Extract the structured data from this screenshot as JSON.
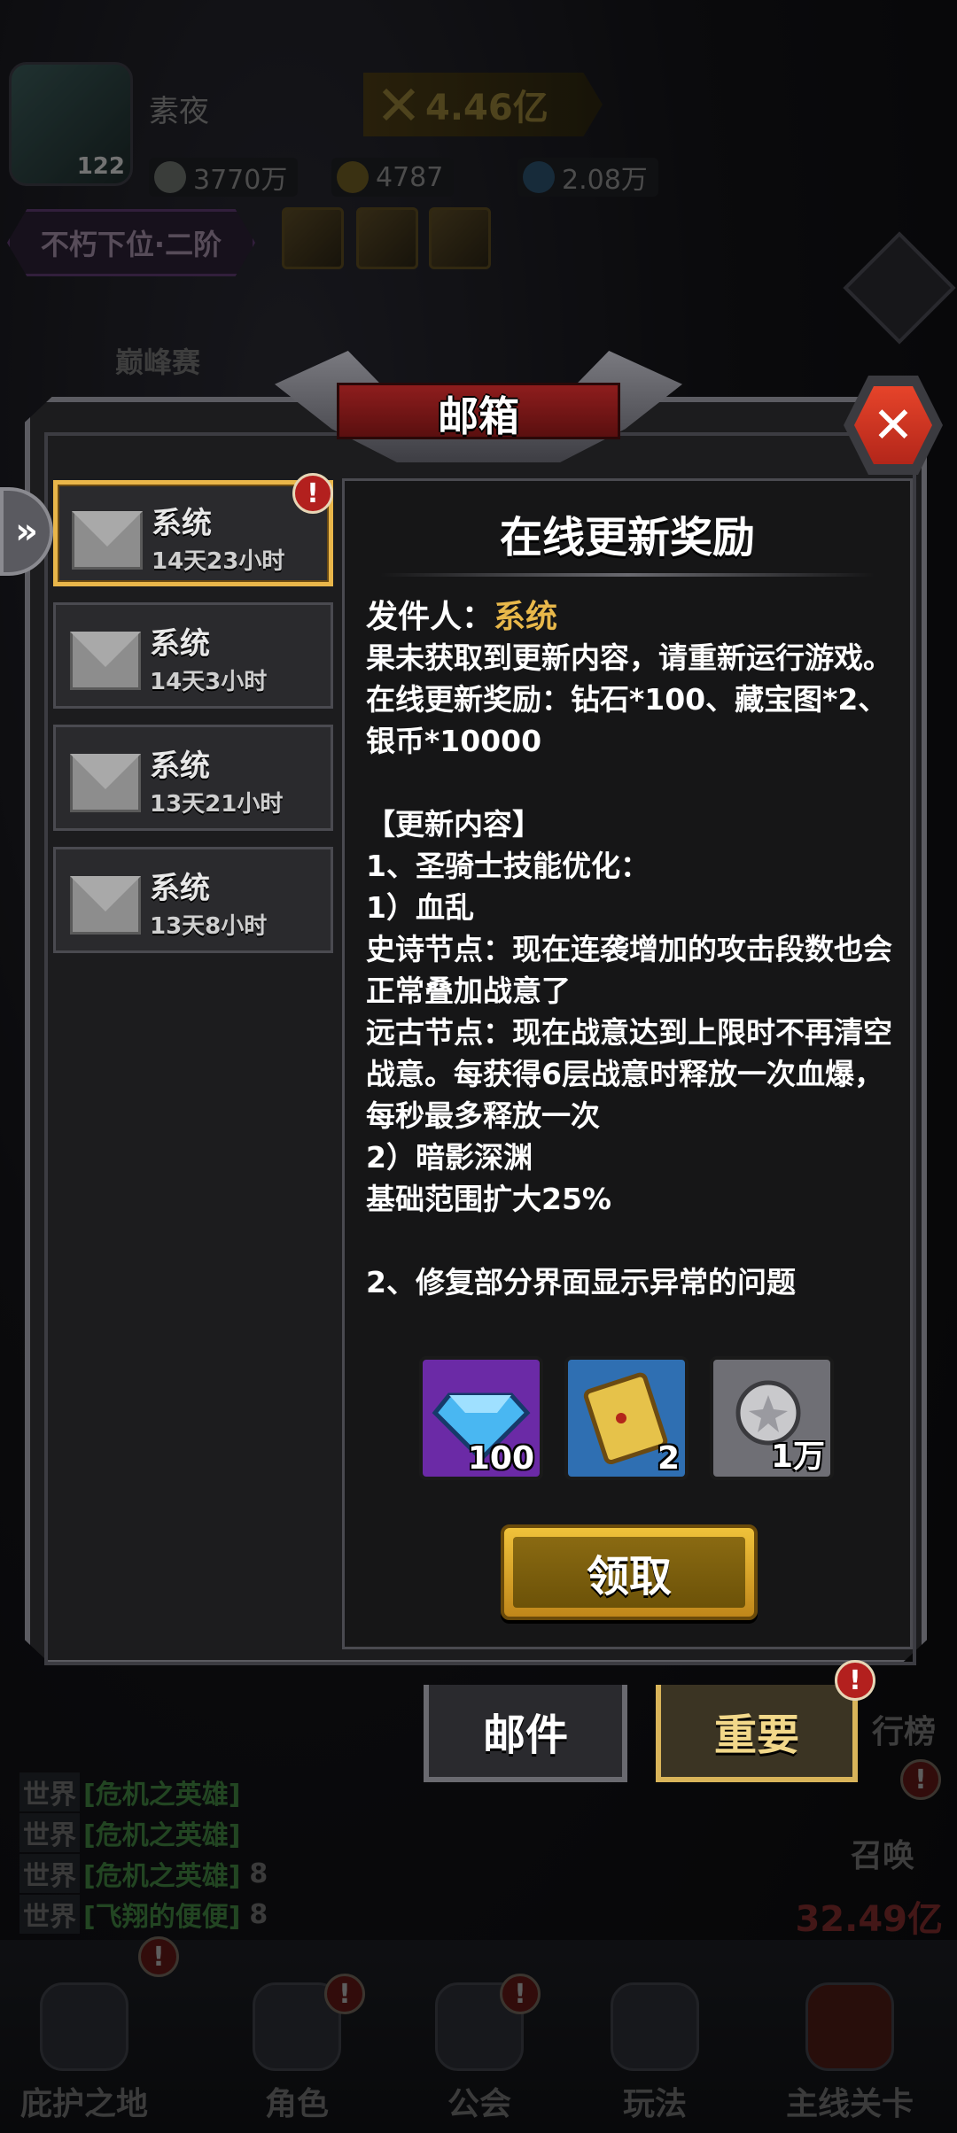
{
  "hud": {
    "player_name": "素夜",
    "player_level": "122",
    "power": "4.46亿",
    "resources": [
      {
        "icon": "silver-coin-icon",
        "value": "3770万"
      },
      {
        "icon": "gold-coin-icon",
        "value": "4787"
      },
      {
        "icon": "diamond-icon",
        "value": "2.08万"
      }
    ],
    "rank_title": "不朽下位·二阶",
    "peak_event": "巅峰赛",
    "chat": [
      {
        "tag": "世界",
        "msg": "[危机之英雄]",
        "num": ""
      },
      {
        "tag": "世界",
        "msg": "[危机之英雄]",
        "num": ""
      },
      {
        "tag": "世界",
        "msg": "[危机之英雄]",
        "num": "8"
      },
      {
        "tag": "世界",
        "msg": "[飞翔的便便]",
        "num": "8"
      }
    ],
    "side_labels": {
      "leaderboard": "行榜",
      "summon": "召唤"
    },
    "bottom_power": "32.49亿",
    "nav": [
      {
        "label": "庇护之地",
        "icon": "castle-icon"
      },
      {
        "label": "角色",
        "icon": "character-icon"
      },
      {
        "label": "公会",
        "icon": "guild-icon"
      },
      {
        "label": "玩法",
        "icon": "skull-icon"
      },
      {
        "label": "主线关卡",
        "icon": "stage-icon"
      }
    ]
  },
  "mailbox": {
    "title": "邮箱",
    "close_label": "✕",
    "mails": [
      {
        "sender": "系统",
        "time": "14天23小时",
        "selected": true,
        "badge": "!"
      },
      {
        "sender": "系统",
        "time": "14天3小时",
        "selected": false
      },
      {
        "sender": "系统",
        "time": "13天21小时",
        "selected": false
      },
      {
        "sender": "系统",
        "time": "13天8小时",
        "selected": false
      }
    ],
    "detail": {
      "title": "在线更新奖励",
      "sender_label": "发件人：",
      "sender_value": "系统",
      "body": "果未获取到更新内容，请重新运行游戏。\n在线更新奖励：钻石*100、藏宝图*2、银币*10000\n\n【更新内容】\n1、圣骑士技能优化：\n1）血乱\n史诗节点：现在连袭增加的攻击段数也会正常叠加战意了\n远古节点：现在战意达到上限时不再清空战意。每获得6层战意时释放一次血爆，每秒最多释放一次\n2）暗影深渊\n基础范围扩大25%\n\n2、修复部分界面显示异常的问题",
      "rewards": [
        {
          "icon": "diamond-icon",
          "count": "100",
          "color": "#6b2aa6"
        },
        {
          "icon": "treasure-map-icon",
          "count": "2",
          "color": "#2f6fb2"
        },
        {
          "icon": "silver-coin-icon",
          "count": "1万",
          "color": "#6f6f75"
        }
      ],
      "claim_label": "领取"
    },
    "tabs": {
      "mail": "邮件",
      "important": "重要"
    }
  }
}
